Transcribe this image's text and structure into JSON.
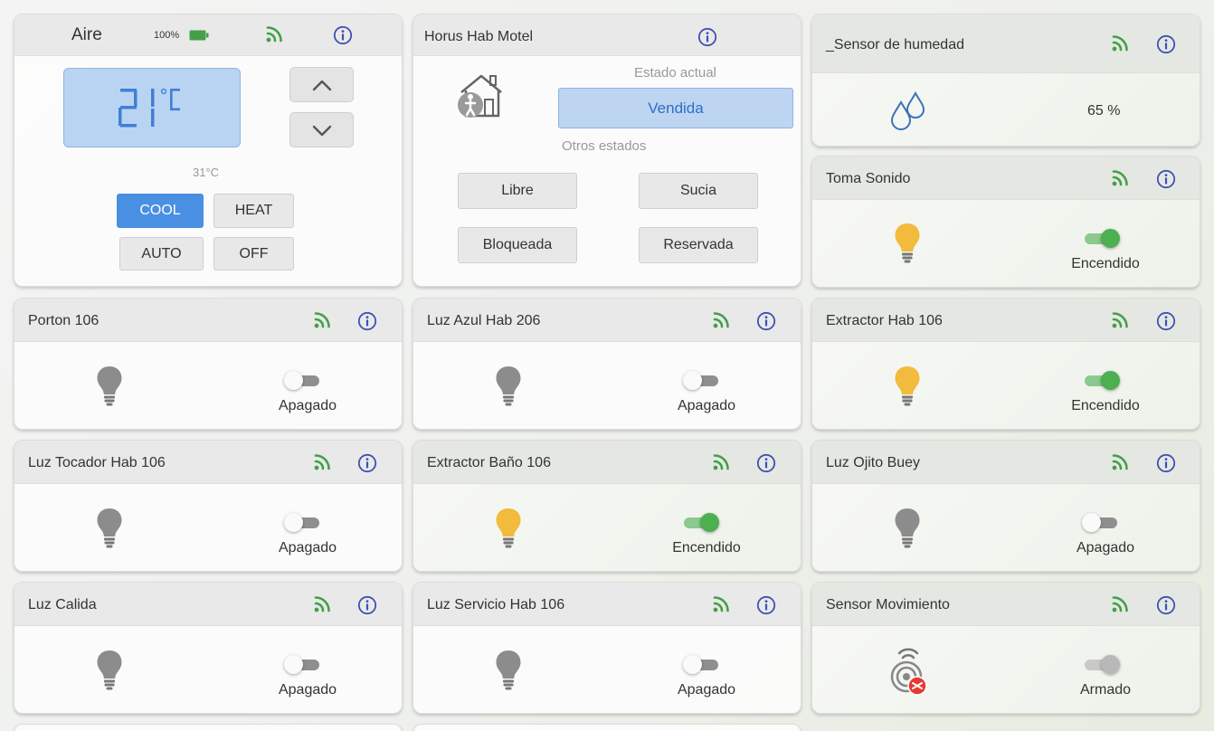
{
  "thermostat": {
    "title": "Aire",
    "battery": "100%",
    "setpoint": "21",
    "unit": "°C",
    "ambient": "31°C",
    "modes": {
      "cool": "COOL",
      "heat": "HEAT",
      "auto": "AUTO",
      "off": "OFF"
    },
    "active_mode": "COOL"
  },
  "room": {
    "title": "Horus Hab Motel",
    "current_label": "Estado actual",
    "current_state": "Vendida",
    "other_label": "Otros estados",
    "options": {
      "libre": "Libre",
      "sucia": "Sucia",
      "bloqueada": "Bloqueada",
      "reservada": "Reservada"
    }
  },
  "humidity": {
    "title": "_Sensor de humedad",
    "value": "65 %"
  },
  "devices": {
    "toma_sonido": {
      "title": "Toma Sonido",
      "state": "Encendido",
      "on": true
    },
    "porton_106": {
      "title": "Porton 106",
      "state": "Apagado",
      "on": false
    },
    "luz_azul_206": {
      "title": "Luz Azul Hab 206",
      "state": "Apagado",
      "on": false
    },
    "extractor_hab_106": {
      "title": "Extractor Hab 106",
      "state": "Encendido",
      "on": true
    },
    "luz_tocador_106": {
      "title": "Luz Tocador Hab 106",
      "state": "Apagado",
      "on": false
    },
    "extractor_bano_106": {
      "title": "Extractor Baño 106",
      "state": "Encendido",
      "on": true
    },
    "luz_ojito_buey": {
      "title": "Luz Ojito Buey",
      "state": "Apagado",
      "on": false
    },
    "luz_calida": {
      "title": "Luz Calida",
      "state": "Apagado",
      "on": false
    },
    "luz_servicio_106": {
      "title": "Luz Servicio Hab 106",
      "state": "Apagado",
      "on": false
    },
    "sensor_movimiento": {
      "title": "Sensor Movimiento",
      "state": "Armado",
      "on": true
    }
  },
  "colors": {
    "signal": "#43a047",
    "info": "#3f51b5",
    "bulb_on": "#f2bb3d",
    "bulb_off": "#8c8c8c",
    "active_mode": "#4a90e2",
    "switch_on": "#4caf50"
  },
  "icons": {
    "signal": "wifi-signal-icon",
    "info": "info-icon",
    "bulb": "lightbulb-icon",
    "battery": "battery-icon",
    "house": "house-person-icon",
    "water": "water-drops-icon",
    "motion": "motion-sensor-icon",
    "up": "chevron-up-icon",
    "down": "chevron-down-icon"
  }
}
